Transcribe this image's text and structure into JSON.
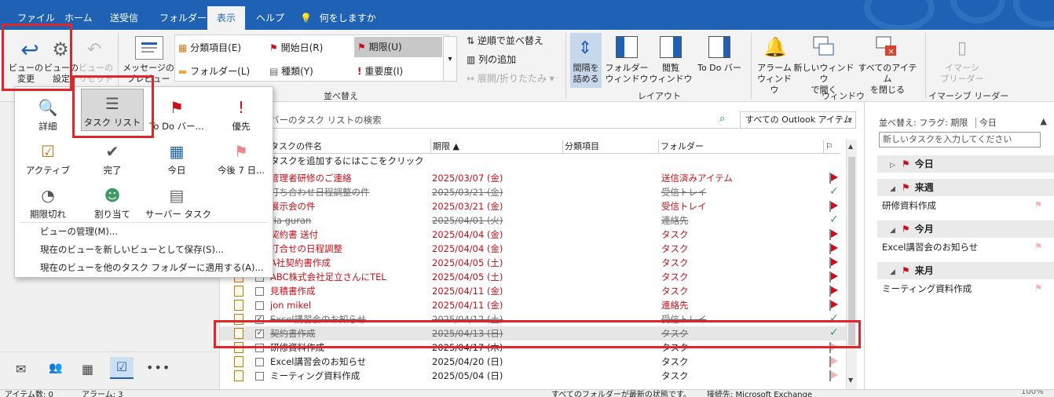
{
  "tabs": [
    "ファイル",
    "ホーム",
    "送受信",
    "フォルダー",
    "表示",
    "ヘルプ",
    "何をしますか"
  ],
  "ribbon": {
    "view_change": "ビューの\n変更",
    "view_settings": "ビューの\n設定",
    "view_reset": "ビューの\nリセット",
    "message_preview": "メッセージの\nプレビュー",
    "arrange": {
      "category": "分類項目(E)",
      "start_date": "開始日(R)",
      "due_date": "期限(U)",
      "folder": "フォルダー(L)",
      "type": "種類(Y)",
      "importance": "重要度(I)"
    },
    "reverse_sort": "逆順で並べ替え",
    "add_column": "列の追加",
    "expand_collapse": "展開/折りたたみ",
    "compact": "間隔を\n詰める",
    "folder_pane": "フォルダー\nウィンドウ",
    "reading_pane": "閲覧\nウィンドウ",
    "todo_bar": "To Do バー",
    "reminders": "アラーム\nウィンドウ",
    "new_window": "新しいウィンドウ\nで開く",
    "close_all": "すべてのアイテム\nを閉じる",
    "immersive": "イマーシ\nブリーダー",
    "groups": {
      "arrange": "並べ替え",
      "layout": "レイアウト",
      "window": "ウィンドウ",
      "immersive": "イマーシブ リーダー"
    }
  },
  "dropdown": {
    "views": [
      {
        "label": "詳細",
        "icon": "detail-icon"
      },
      {
        "label": "タスク リスト",
        "icon": "task-list-icon"
      },
      {
        "label": "To Do バー...",
        "icon": "todo-bar-icon"
      },
      {
        "label": "優先",
        "icon": "priority-icon"
      },
      {
        "label": "アクティブ",
        "icon": "active-icon"
      },
      {
        "label": "完了",
        "icon": "completed-icon"
      },
      {
        "label": "今日",
        "icon": "today-icon"
      },
      {
        "label": "今後 7 日...",
        "icon": "next7-icon"
      },
      {
        "label": "期限切れ",
        "icon": "overdue-icon"
      },
      {
        "label": "割り当て",
        "icon": "assigned-icon"
      },
      {
        "label": "サーバー タスク",
        "icon": "server-task-icon"
      }
    ],
    "menu": [
      "ビューの管理(M)...",
      "現在のビューを新しいビューとして保存(S)...",
      "現在のビューを他のタスク フォルダーに適用する(A)..."
    ]
  },
  "search": {
    "placeholder": "バーのタスク リストの検索",
    "scope": "すべての Outlook アイテム"
  },
  "columns": {
    "subject": "タスクの件名",
    "due": "期限 ▲",
    "category": "分類項目",
    "folder": "フォルダー"
  },
  "add_task_hint": "タスクを追加するにはここをクリック",
  "tasks": [
    {
      "subject": "管理者研修のご連絡",
      "due": "2025/03/07 (金)",
      "folder": "送信済みアイテム",
      "state": "overdue"
    },
    {
      "subject": "打ち合わせ日程調整の件",
      "due": "2025/03/21 (金)",
      "folder": "受信トレイ",
      "state": "done"
    },
    {
      "subject": "展示会の件",
      "due": "2025/03/21 (金)",
      "folder": "受信トレイ",
      "state": "overdue"
    },
    {
      "subject": "ria guran",
      "due": "2025/04/01 (火)",
      "folder": "連絡先",
      "state": "done"
    },
    {
      "subject": "契約書 送付",
      "due": "2025/04/04 (金)",
      "folder": "タスク",
      "state": "overdue"
    },
    {
      "subject": "打合せの日程調整",
      "due": "2025/04/04 (金)",
      "folder": "タスク",
      "state": "overdue"
    },
    {
      "subject": "A社契約書作成",
      "due": "2025/04/05 (土)",
      "folder": "タスク",
      "state": "overdue"
    },
    {
      "subject": "ABC株式会社足立さんにTEL",
      "due": "2025/04/05 (土)",
      "folder": "タスク",
      "state": "overdue"
    },
    {
      "subject": "見積書作成",
      "due": "2025/04/11 (金)",
      "folder": "タスク",
      "state": "overdue"
    },
    {
      "subject": "jon mikel",
      "due": "2025/04/11 (金)",
      "folder": "連絡先",
      "state": "overdue"
    },
    {
      "subject": "Excel講習会のお知らせ",
      "due": "2025/04/12 (土)",
      "folder": "受信トレイ",
      "state": "done"
    },
    {
      "subject": "契約書作成",
      "due": "2025/04/13 (日)",
      "folder": "タスク",
      "state": "done-selected"
    },
    {
      "subject": "研修資料作成",
      "due": "2025/04/17 (木)",
      "folder": "タスク",
      "state": "normal"
    },
    {
      "subject": "Excel講習会のお知らせ",
      "due": "2025/04/20 (日)",
      "folder": "タスク",
      "state": "normal"
    },
    {
      "subject": "ミーティング資料作成",
      "due": "2025/05/04 (日)",
      "folder": "タスク",
      "state": "normal"
    }
  ],
  "todo": {
    "sort_label": "並べ替え: フラグ: 期限",
    "sort_value": "今日",
    "new_task_placeholder": "新しいタスクを入力してください",
    "groups": [
      {
        "label": "今日",
        "items": []
      },
      {
        "label": "来週",
        "items": [
          "研修資料作成"
        ]
      },
      {
        "label": "今月",
        "items": [
          "Excel講習会のお知らせ"
        ]
      },
      {
        "label": "来月",
        "items": [
          "ミーティング資料作成"
        ]
      }
    ]
  },
  "status": {
    "items": "アイテム数: 0",
    "reminders": "アラーム: 3",
    "sync": "すべてのフォルダーが最新の状態です。",
    "connection": "接続先: Microsoft Exchange",
    "zoom": "100%"
  },
  "colors": {
    "accent": "#1f62b5",
    "overdue": "#c8101a",
    "highlight": "#e0262b",
    "completed": "#3c9a63"
  }
}
